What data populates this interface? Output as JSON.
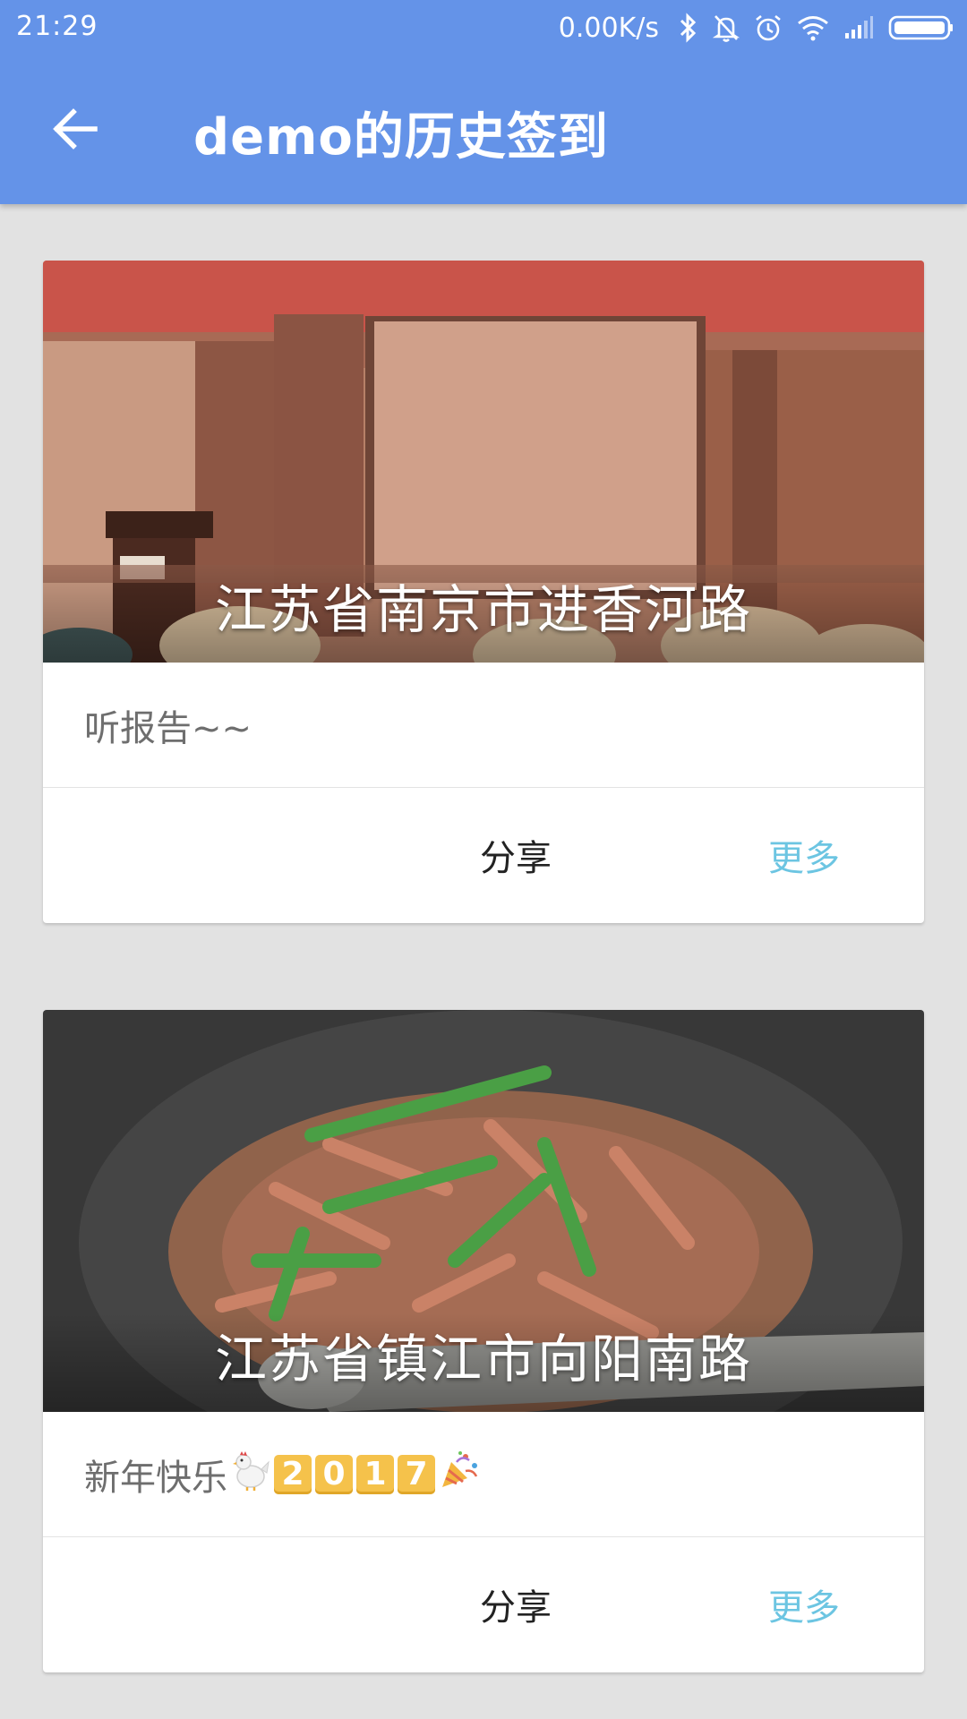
{
  "status_bar": {
    "time": "21:29",
    "net_speed": "0.00K/s",
    "icons": [
      "bluetooth-icon",
      "bell-off-icon",
      "alarm-icon",
      "wifi-icon",
      "signal-icon",
      "battery-icon"
    ]
  },
  "toolbar": {
    "title": "demo的历史签到",
    "back_icon": "arrow-left-icon"
  },
  "colors": {
    "app_bar": "#6493e8",
    "background": "#e2e2e2",
    "more_link": "#6cc5e2"
  },
  "cards": [
    {
      "location": "江苏省南京市进香河路",
      "note": "听报告~~",
      "share_label": "分享",
      "more_label": "更多",
      "image": "lecture-hall-photo"
    },
    {
      "location": "江苏省镇江市向阳南路",
      "note": "新年快乐",
      "note_emojis": [
        "rooster-emoji",
        "party-popper-emoji"
      ],
      "note_digits": [
        "2",
        "0",
        "1",
        "7"
      ],
      "share_label": "分享",
      "more_label": "更多",
      "image": "stir-fry-wok-photo"
    }
  ]
}
